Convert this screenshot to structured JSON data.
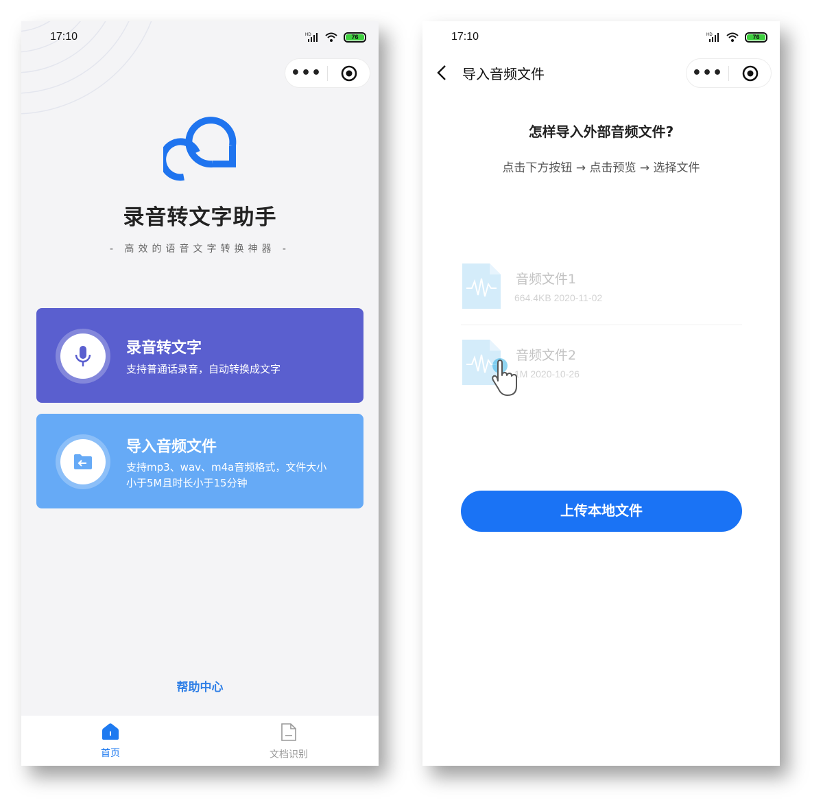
{
  "left": {
    "status": {
      "time": "17:10",
      "battery": "76"
    },
    "app": {
      "title": "录音转文字助手",
      "subtitle": "- 高效的语音文字转换神器 -"
    },
    "cards": [
      {
        "title": "录音转文字",
        "desc": "支持普通话录音，自动转换成文字",
        "icon": "microphone-icon"
      },
      {
        "title": "导入音频文件",
        "desc": "支持mp3、wav、m4a音频格式，文件大小小于5M且时长小于15分钟",
        "icon": "folder-import-icon"
      }
    ],
    "help": "帮助中心",
    "tabs": [
      {
        "label": "首页",
        "icon": "home-icon",
        "active": true
      },
      {
        "label": "文档识别",
        "icon": "document-icon",
        "active": false
      }
    ]
  },
  "right": {
    "status": {
      "time": "17:10",
      "battery": "76"
    },
    "nav": {
      "title": "导入音频文件"
    },
    "question": "怎样导入外部音频文件?",
    "steps": "点击下方按钮 → 点击预览 → 选择文件",
    "files": [
      {
        "name": "音频文件1",
        "meta": "664.4KB 2020-11-02"
      },
      {
        "name": "音频文件2",
        "meta": "1M 2020-10-26"
      }
    ],
    "upload": "上传本地文件"
  },
  "colors": {
    "primary": "#1a73f5",
    "record_card": "#5a5fcf",
    "import_card": "#66aaf6",
    "help_link": "#2f7fe6"
  }
}
